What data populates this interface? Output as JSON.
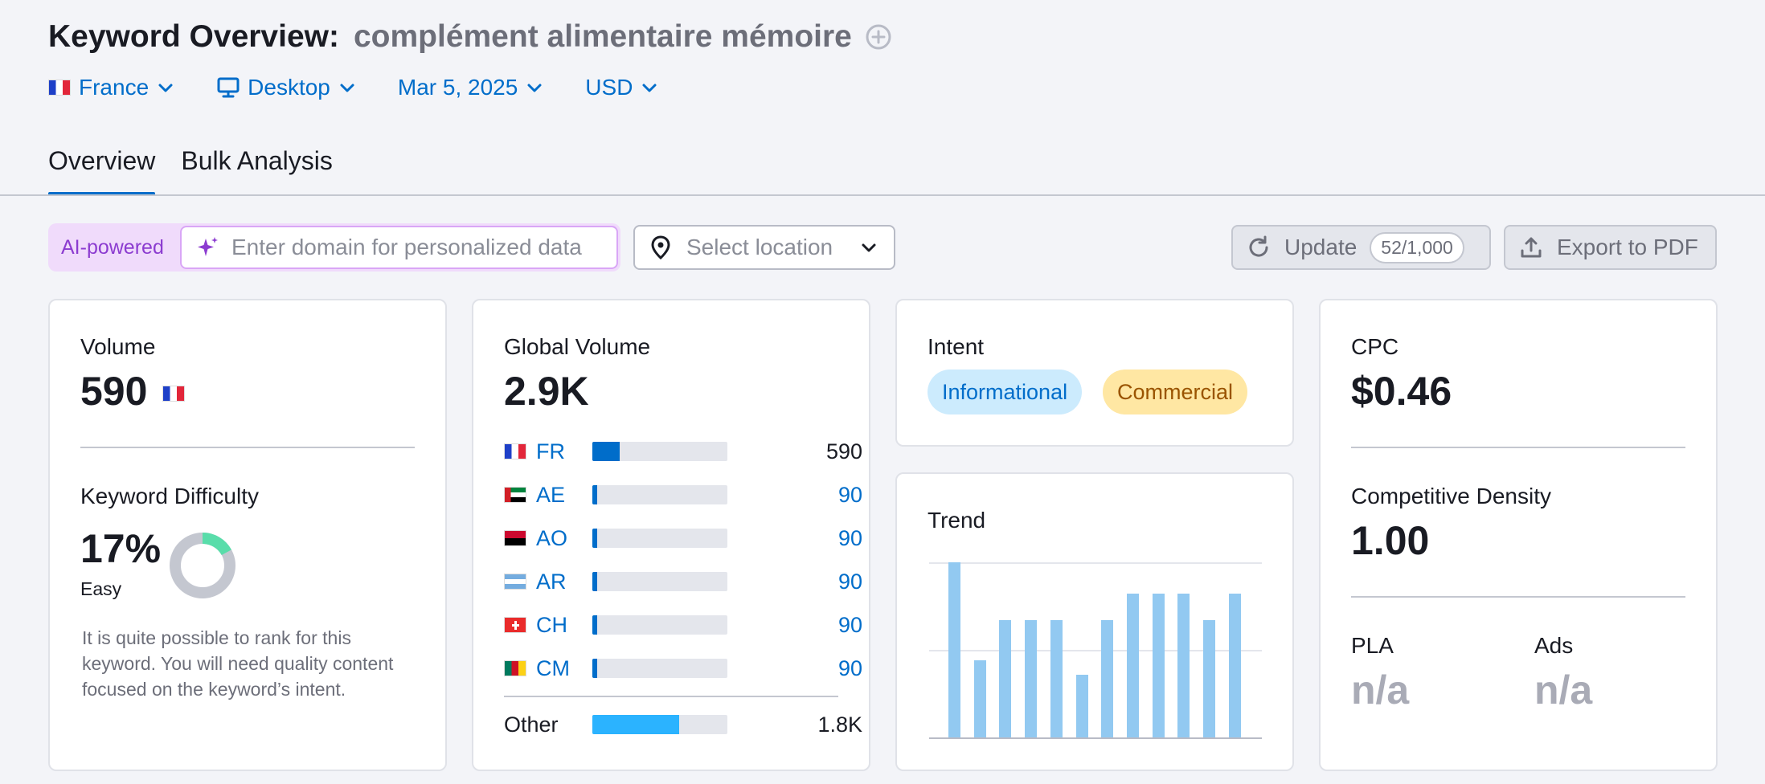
{
  "header": {
    "title": "Keyword Overview:",
    "keyword": "complément alimentaire mémoire"
  },
  "filters": {
    "country": "France",
    "device": "Desktop",
    "date": "Mar 5, 2025",
    "currency": "USD"
  },
  "tabs": [
    {
      "label": "Overview",
      "active": true
    },
    {
      "label": "Bulk Analysis",
      "active": false
    }
  ],
  "toolbar": {
    "ai_label": "AI-powered",
    "domain_placeholder": "Enter domain for personalized data",
    "location_placeholder": "Select location",
    "update_label": "Update",
    "update_count": "52/1,000",
    "export_label": "Export to PDF"
  },
  "volume": {
    "label": "Volume",
    "value": "590"
  },
  "keyword_difficulty": {
    "label": "Keyword Difficulty",
    "value": "17%",
    "percent": 17,
    "level": "Easy",
    "description": "It is quite possible to rank for this keyword. You will need quality content focused on the keyword’s intent."
  },
  "global_volume": {
    "label": "Global Volume",
    "value": "2.9K",
    "countries": [
      {
        "code": "FR",
        "value": "590",
        "share": 0.2
      },
      {
        "code": "AE",
        "value": "90",
        "share": 0.035
      },
      {
        "code": "AO",
        "value": "90",
        "share": 0.035
      },
      {
        "code": "AR",
        "value": "90",
        "share": 0.035
      },
      {
        "code": "CH",
        "value": "90",
        "share": 0.035
      },
      {
        "code": "CM",
        "value": "90",
        "share": 0.035
      }
    ],
    "other": {
      "label": "Other",
      "value": "1.8K",
      "share": 0.64
    }
  },
  "intent": {
    "label": "Intent",
    "tags": [
      "Informational",
      "Commercial"
    ]
  },
  "trend": {
    "label": "Trend",
    "values": [
      1.0,
      0.44,
      0.67,
      0.67,
      0.67,
      0.36,
      0.67,
      0.82,
      0.82,
      0.82,
      0.67,
      0.82
    ]
  },
  "cpc": {
    "label": "CPC",
    "value": "$0.46"
  },
  "competitive_density": {
    "label": "Competitive Density",
    "value": "1.00"
  },
  "pla": {
    "label": "PLA",
    "value": "n/a"
  },
  "ads": {
    "label": "Ads",
    "value": "n/a"
  },
  "colors": {
    "accent": "#006dca",
    "kd_green": "#59ddaa",
    "trend_bar": "#92c9f1",
    "other_bar": "#2bb3ff"
  }
}
